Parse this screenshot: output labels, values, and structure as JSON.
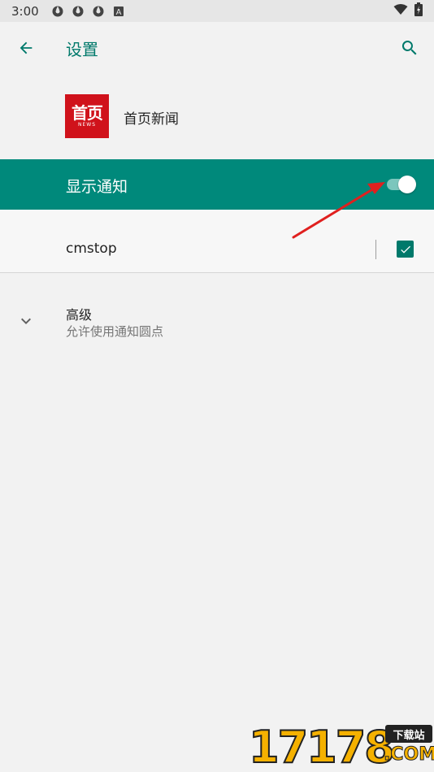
{
  "status_bar": {
    "time": "3:00",
    "notification_icons": [
      "gear-like-icon",
      "gear-like-icon",
      "gear-like-icon",
      "a-box-icon"
    ],
    "right_icons": [
      "wifi-icon",
      "battery-icon"
    ]
  },
  "app_bar": {
    "title": "设置",
    "back_icon": "arrow-left-icon",
    "search_icon": "search-icon"
  },
  "app_info": {
    "logo_text": "首页",
    "logo_sub": "NEWS",
    "name": "首页新闻"
  },
  "notifications": {
    "label": "显示通知",
    "enabled": true
  },
  "channel": {
    "label": "cmstop",
    "checked": true
  },
  "advanced": {
    "title": "高级",
    "subtitle": "允许使用通知圆点"
  },
  "watermark": {
    "digits": "17178",
    "badge": "下载站",
    "suffix": ".COM"
  },
  "colors": {
    "accent": "#00796b",
    "highlight_row": "#00897b",
    "arrow": "#e0201f",
    "brand_red": "#d0121b"
  }
}
